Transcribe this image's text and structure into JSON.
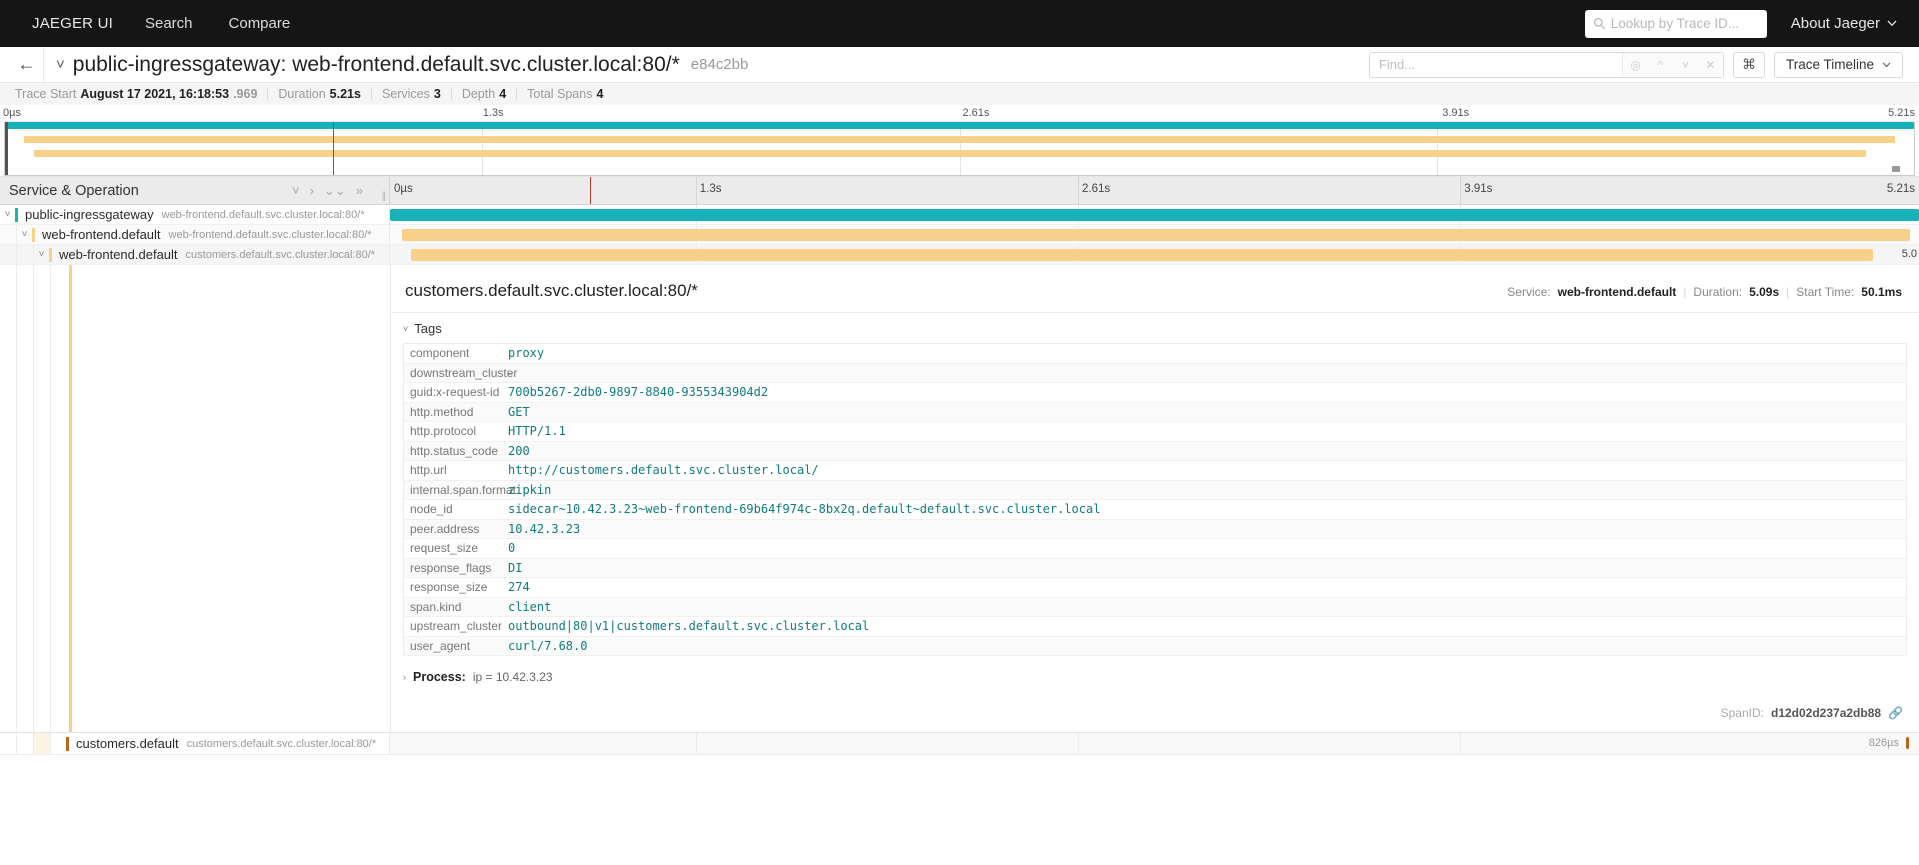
{
  "topnav": {
    "brand": "JAEGER UI",
    "links": [
      "Search",
      "Compare"
    ],
    "lookup_placeholder": "Lookup by Trace ID...",
    "about_label": "About Jaeger",
    "search_icon": "search-icon",
    "chevron_icon": "chevron-down-icon"
  },
  "trace_header": {
    "back_icon": "back-arrow-icon",
    "collapse_icon": "chevron-down-icon",
    "title": "public-ingressgateway: web-frontend.default.svc.cluster.local:80/*",
    "trace_id": "e84c2bb",
    "find_placeholder": "Find...",
    "find_value": "",
    "find_buttons": [
      "focus-icon",
      "prev-icon",
      "next-icon",
      "clear-icon"
    ],
    "kbd_label": "⌘",
    "view_selector": "Trace Timeline",
    "view_chevron": "chevron-down-icon"
  },
  "summary": {
    "items": [
      {
        "label": "Trace Start",
        "value": "August 17 2021, 16:18:53",
        "fraction": ".969"
      },
      {
        "label": "Duration",
        "value": "5.21s",
        "fraction": ""
      },
      {
        "label": "Services",
        "value": "3",
        "fraction": ""
      },
      {
        "label": "Depth",
        "value": "4",
        "fraction": ""
      },
      {
        "label": "Total Spans",
        "value": "4",
        "fraction": ""
      }
    ]
  },
  "minimap": {
    "ticks": [
      "0µs",
      "1.3s",
      "2.61s",
      "3.91s",
      "5.21s"
    ],
    "cursor_percent": 17.2
  },
  "timeline_header": {
    "column_title": "Service & Operation",
    "controls": [
      "collapse-one-icon",
      "expand-one-icon",
      "collapse-all-icon",
      "expand-all-icon"
    ],
    "ticks": [
      "0µs",
      "1.3s",
      "2.61s",
      "3.91s",
      "5.21s"
    ],
    "cursor_percent": 17.2
  },
  "spans": [
    {
      "service": "public-ingressgateway",
      "operation": "web-frontend.default.svc.cluster.local:80/*",
      "depth": 0,
      "color": "#17b2b7",
      "bar_left_pct": 0,
      "bar_width_pct": 100,
      "bar_label": "",
      "expanded": true
    },
    {
      "service": "web-frontend.default",
      "operation": "web-frontend.default.svc.cluster.local:80/*",
      "depth": 1,
      "color": "#f7d08a",
      "bar_left_pct": 0.8,
      "bar_width_pct": 98.6,
      "bar_label": "",
      "expanded": true
    },
    {
      "service": "web-frontend.default",
      "operation": "customers.default.svc.cluster.local:80/*",
      "depth": 2,
      "color": "#f7d08a",
      "bar_left_pct": 1.4,
      "bar_width_pct": 95.6,
      "bar_label": "5.0",
      "expanded": true,
      "selected": true
    },
    {
      "service": "customers.default",
      "operation": "customers.default.svc.cluster.local:80/*",
      "depth": 3,
      "color": "#b5651d",
      "bar_left_pct": 96.5,
      "bar_width_pct": 0.3,
      "bar_label": "826µs",
      "expanded": false
    }
  ],
  "detail": {
    "title": "customers.default.svc.cluster.local:80/*",
    "meta": {
      "service_label": "Service:",
      "service_value": "web-frontend.default",
      "duration_label": "Duration:",
      "duration_value": "5.09s",
      "start_label": "Start Time:",
      "start_value": "50.1ms"
    },
    "tags_section_label": "Tags",
    "tags": [
      {
        "key": "component",
        "value": "proxy"
      },
      {
        "key": "downstream_cluster",
        "value": "-",
        "plain": true
      },
      {
        "key": "guid:x-request-id",
        "value": "700b5267-2db0-9897-8840-9355343904d2"
      },
      {
        "key": "http.method",
        "value": "GET"
      },
      {
        "key": "http.protocol",
        "value": "HTTP/1.1"
      },
      {
        "key": "http.status_code",
        "value": "200"
      },
      {
        "key": "http.url",
        "value": "http://customers.default.svc.cluster.local/"
      },
      {
        "key": "internal.span.format",
        "value": "zipkin"
      },
      {
        "key": "node_id",
        "value": "sidecar~10.42.3.23~web-frontend-69b64f974c-8bx2q.default~default.svc.cluster.local"
      },
      {
        "key": "peer.address",
        "value": "10.42.3.23"
      },
      {
        "key": "request_size",
        "value": "0"
      },
      {
        "key": "response_flags",
        "value": "DI"
      },
      {
        "key": "response_size",
        "value": "274"
      },
      {
        "key": "span.kind",
        "value": "client"
      },
      {
        "key": "upstream_cluster",
        "value": "outbound|80|v1|customers.default.svc.cluster.local"
      },
      {
        "key": "user_agent",
        "value": "curl/7.68.0"
      }
    ],
    "process_label": "Process:",
    "process_value": "ip = 10.42.3.23",
    "spanid_label": "SpanID:",
    "spanid_value": "d12d02d237a2db88",
    "link_icon": "link-icon"
  },
  "colors": {
    "accent_teal": "#17b2b7",
    "bar_yellow": "#f7d08a",
    "bar_brown": "#b5651d",
    "tag_value": "#127b7b",
    "cursor_red": "#c0392b"
  }
}
